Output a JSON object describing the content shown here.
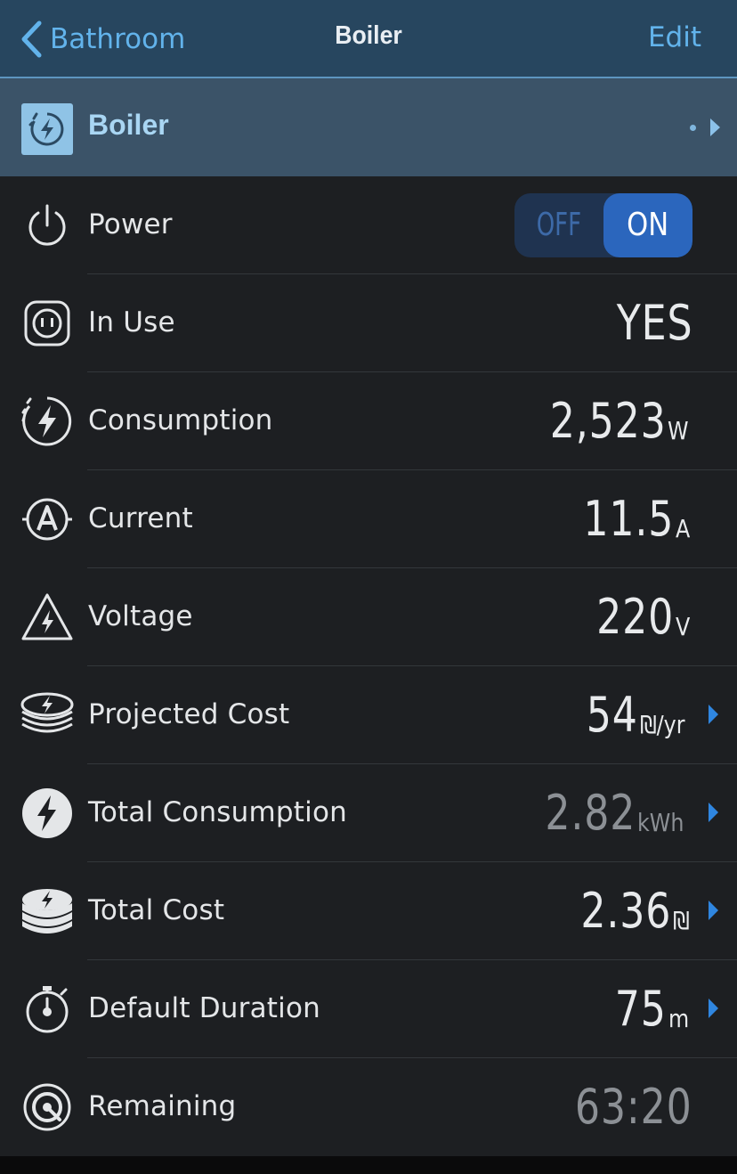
{
  "navbar": {
    "back_label": "Bathroom",
    "title": "Boiler",
    "edit_label": "Edit"
  },
  "device": {
    "name": "Boiler"
  },
  "rows": {
    "power": {
      "label": "Power",
      "off_label": "OFF",
      "on_label": "ON",
      "state": "ON"
    },
    "in_use": {
      "label": "In Use",
      "value": "YES"
    },
    "consumption": {
      "label": "Consumption",
      "value": "2,523",
      "unit": "W"
    },
    "current": {
      "label": "Current",
      "value": "11.5",
      "unit": "A"
    },
    "voltage": {
      "label": "Voltage",
      "value": "220",
      "unit": "V"
    },
    "projected_cost": {
      "label": "Projected Cost",
      "value": "54",
      "unit": "₪/yr"
    },
    "total_consumption": {
      "label": "Total Consumption",
      "value": "2.82",
      "unit": "kWh"
    },
    "total_cost": {
      "label": "Total Cost",
      "value": "2.36",
      "unit": "₪"
    },
    "default_duration": {
      "label": "Default Duration",
      "value": "75",
      "unit": "m"
    },
    "remaining": {
      "label": "Remaining",
      "value": "63:20"
    }
  },
  "colors": {
    "accent": "#62b3eb",
    "navbar_bg": "#27465f",
    "device_bar_bg": "#3b5368",
    "list_bg": "#1d1f22",
    "toggle_on": "#2b66bd",
    "chevron": "#2f86e0"
  }
}
